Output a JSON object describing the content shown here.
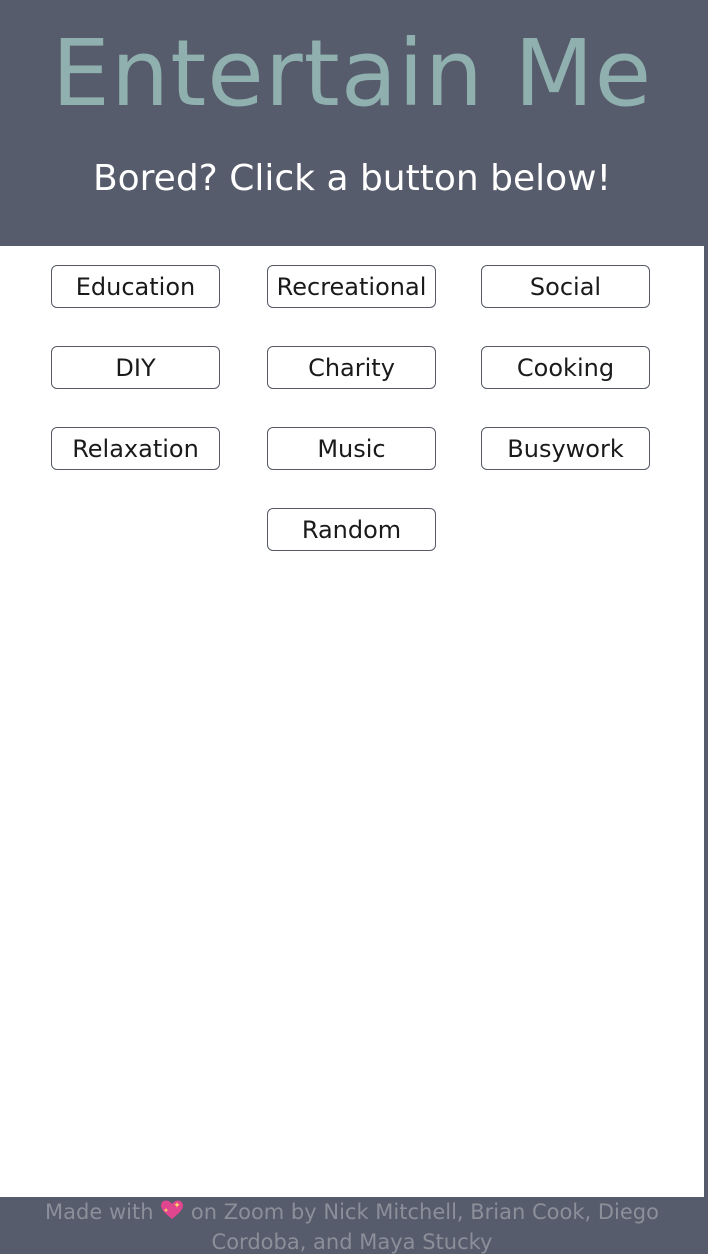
{
  "header": {
    "title": "Entertain Me",
    "subtitle": "Bored? Click a button below!"
  },
  "buttons": [
    "Education",
    "Recreational",
    "Social",
    "DIY",
    "Charity",
    "Cooking",
    "Relaxation",
    "Music",
    "Busywork",
    "Random"
  ],
  "footer": {
    "prefix": "Made with",
    "icon": "sparkling-heart-icon",
    "suffix": "on Zoom by Nick Mitchell, Brian Cook, Diego Cordoba, and Maya Stucky"
  },
  "colors": {
    "header_bg": "#565c6b",
    "title": "#8fb0ae",
    "subtitle": "#ffffff",
    "footer_text": "#8a8f9a",
    "heart": "#e0468f"
  }
}
